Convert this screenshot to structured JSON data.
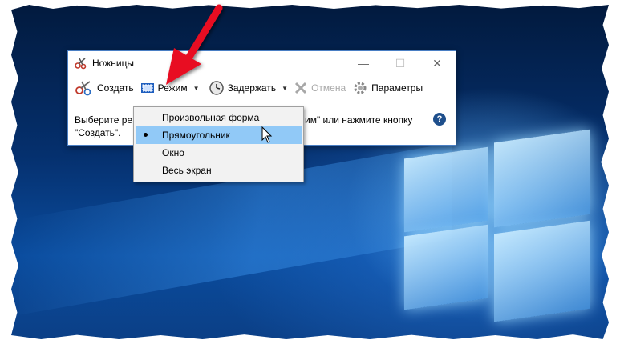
{
  "window": {
    "title": "Ножницы",
    "minimize_glyph": "—",
    "maximize_glyph": "☐",
    "close_glyph": "✕"
  },
  "toolbar": {
    "new_label": "Создать",
    "mode_label": "Режим",
    "delay_label": "Задержать",
    "cancel_label": "Отмена",
    "options_label": "Параметры"
  },
  "message": {
    "line1_start": "Выберите ре",
    "line1_end": "им\" или нажмите кнопку",
    "line2": "\"Создать\"."
  },
  "mode_menu": {
    "items": [
      {
        "label": "Произвольная форма",
        "selected": false
      },
      {
        "label": "Прямоугольник",
        "selected": true
      },
      {
        "label": "Окно",
        "selected": false
      },
      {
        "label": "Весь экран",
        "selected": false
      }
    ]
  },
  "help_glyph": "?",
  "colors": {
    "accent_arrow": "#e81123",
    "menu_highlight": "#91c9f7",
    "window_border": "#4a7fc4"
  }
}
